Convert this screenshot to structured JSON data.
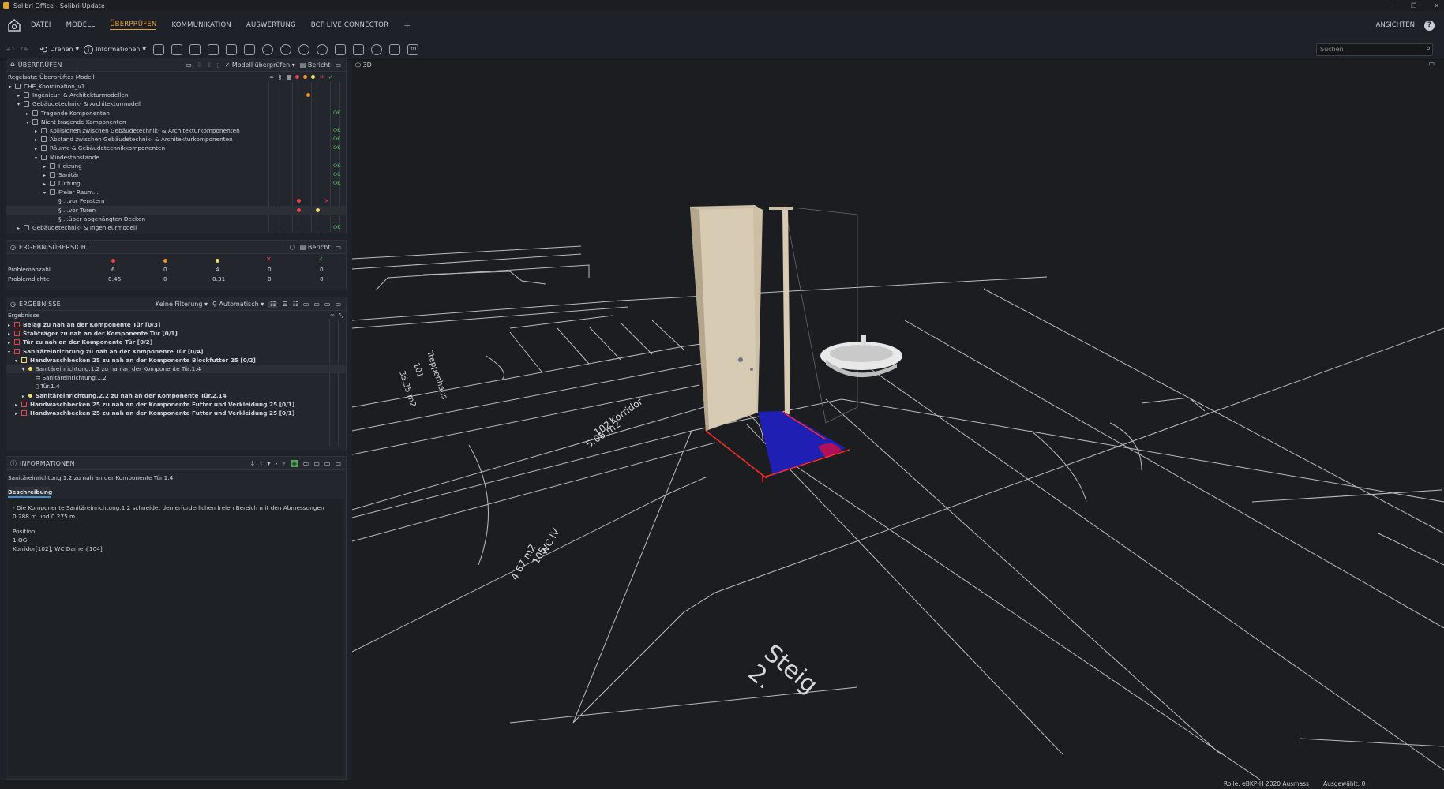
{
  "window": {
    "title": "Solibri Office - Solibri-Update"
  },
  "menu": {
    "items": [
      "DATEI",
      "MODELL",
      "ÜBERPRÜFEN",
      "KOMMUNIKATION",
      "AUSWERTUNG",
      "BCF LIVE CONNECTOR"
    ],
    "active": "ÜBERPRÜFEN",
    "add": "+",
    "ansichten": "ANSICHTEN",
    "help": "?"
  },
  "toolbar": {
    "rotate_label": "Drehen",
    "info_label": "Informationen",
    "search_placeholder": "Suchen"
  },
  "check_panel": {
    "title": "ÜBERPRÜFEN",
    "check_model": "Modell überprüfen",
    "report": "Bericht",
    "ruleset_label": "Regelsatz: Überprüftes Modell",
    "rows": [
      {
        "label": "CHE_Koordination_v1",
        "status": ""
      },
      {
        "label": "Ingenieur- & Architekturmodellen",
        "status": "orange"
      },
      {
        "label": "Gebäudetechnik- & Architekturmodell",
        "status": ""
      },
      {
        "label": "Tragende Komponenten",
        "status": "OK"
      },
      {
        "label": "Nicht tragende Komponenten",
        "status": ""
      },
      {
        "label": "Kollisionen zwischen Gebäudetechnik- & Architekturkomponenten",
        "status": "OK"
      },
      {
        "label": "Abstand zwischen Gebäudetechnik- & Architekturkomponenten",
        "status": "OK"
      },
      {
        "label": "Räume & Gebäudetechnikkomponenten",
        "status": "OK"
      },
      {
        "label": "Mindestabstände",
        "status": ""
      },
      {
        "label": "Heizung",
        "status": "OK"
      },
      {
        "label": "Sanitär",
        "status": "OK"
      },
      {
        "label": "Lüftung",
        "status": "OK"
      },
      {
        "label": "Freier Raum...",
        "status": ""
      },
      {
        "label": "...vor Fenstern",
        "status": "red-x"
      },
      {
        "label": "...vor Türen",
        "status": "red-yellow"
      },
      {
        "label": "...über abgehängten Decken",
        "status": "dash"
      },
      {
        "label": "Gebäudetechnik- & Ingenieurmodell",
        "status": "OK"
      }
    ]
  },
  "summary_panel": {
    "title": "ERGEBNISÜBERSICHT",
    "report": "Bericht",
    "row_labels": [
      "Problemanzahl",
      "Problemdichte"
    ],
    "values": [
      [
        "6",
        "0",
        "4",
        "0",
        "0"
      ],
      [
        "0.46",
        "0",
        "0.31",
        "0",
        "0"
      ]
    ]
  },
  "results_panel": {
    "title": "ERGEBNISSE",
    "filter": "Keine Filterung",
    "auto": "Automatisch",
    "list_header": "Ergebnisse",
    "rows": [
      "Belag zu nah an der Komponente Tür [0/3]",
      "Stabträger zu nah an der Komponente Tür [0/1]",
      "Tür zu nah an der Komponente Tür [0/2]",
      "Sanitäreinrichtung zu nah an der Komponente Tür [0/4]",
      "Handwaschbecken 25 zu nah an der Komponente Blockfutter 25 [0/2]",
      "Sanitäreinrichtung.1.2 zu nah an der Komponente Tür.1.4",
      "Sanitäreinrichtung.1.2",
      "Tür.1.4",
      "Sanitäreinrichtung.2.2 zu nah an der Komponente Tür.2.14",
      "Handwaschbecken 25 zu nah an der Komponente Futter und Verkleidung 25 [0/1]",
      "Handwaschbecken 25 zu nah an der Komponente Futter und Verkleidung 25 [0/1]"
    ]
  },
  "info_panel": {
    "title": "INFORMATIONEN",
    "subject": "Sanitäreinrichtung.1.2 zu nah an der Komponente Tür.1.4",
    "tab": "Beschreibung",
    "line1": "- Die Komponente Sanitäreinrichtung.1.2 schneidet den erforderlichen freien Bereich mit den Abmessungen 0.288 m und 0.275 m.",
    "pos_label": "Position:",
    "pos_floor": "1.OG",
    "pos_rooms": "Korridor[102], WC Damen[104]"
  },
  "viewport": {
    "tab": "3D",
    "room_texts": [
      "Korridor",
      "102",
      "5.08 m2",
      "WC IV",
      "105",
      "4.67 m2",
      "Steig",
      "2.",
      "Treppenhaus",
      "101",
      "35.35 m2"
    ]
  },
  "statusbar": {
    "role": "Rolle: eBKP-H 2020 Ausmass",
    "selected": "Ausgewählt: 0"
  },
  "colors": {
    "accent": "#e8a33a",
    "red": "#e8424c",
    "orange": "#e8902a",
    "yellow": "#f0e06a",
    "ok": "#57c063"
  }
}
